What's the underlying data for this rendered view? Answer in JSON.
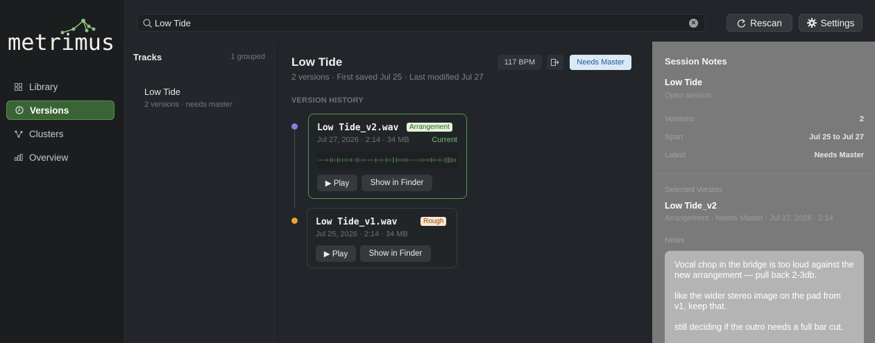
{
  "app": {
    "logo_text": "metrimus"
  },
  "sidebar": {
    "items": [
      {
        "label": "Library",
        "icon": "grid-icon"
      },
      {
        "label": "Versions",
        "icon": "clock-icon",
        "active": true
      },
      {
        "label": "Clusters",
        "icon": "cluster-icon"
      },
      {
        "label": "Overview",
        "icon": "bar-chart-icon"
      }
    ]
  },
  "topbar": {
    "search_value": "Low Tide",
    "rescan_label": "Rescan",
    "settings_label": "Settings"
  },
  "tracks": {
    "title": "Tracks",
    "count": "1 grouped",
    "items": [
      {
        "name": "Low Tide",
        "sub": "2 versions · needs master"
      }
    ]
  },
  "main": {
    "title": "Low Tide",
    "subtitle": "2 versions · First saved Jul 25 · Last modified Jul 27",
    "bpm": "117 BPM",
    "status": "Needs Master",
    "history_label": "VERSION HISTORY",
    "versions": [
      {
        "file": "Low Tide_v2.wav",
        "tag": "Arrangement",
        "meta": "Jul 27, 2026 · 2:14 · 34 MB",
        "current": "Current",
        "play": "▶ Play",
        "finder": "Show in Finder",
        "dot_color": "#8680e0"
      },
      {
        "file": "Low Tide_v1.wav",
        "tag": "Rough",
        "meta": "Jul 25, 2026 · 2:14 · 34 MB",
        "play": "▶ Play",
        "finder": "Show in Finder",
        "dot_color": "#f0a030"
      }
    ]
  },
  "notes": {
    "title": "Session Notes",
    "session_name": "Low Tide",
    "open_label": "Open session",
    "rows": [
      {
        "label": "Versions",
        "value": "2"
      },
      {
        "label": "Span",
        "value": "Jul 25 to Jul 27"
      },
      {
        "label": "Latest",
        "value": "Needs Master"
      }
    ],
    "selected_label": "Selected Version",
    "selected_name": "Low Tide_v2",
    "selected_sub": "Arrangement · Needs Master · Jul 27, 2026 · 2:14",
    "notes_label": "Notes",
    "note_paragraphs": [
      "Vocal chop in the bridge is too loud against the new arrangement — pull back 2-3db.",
      "like the wider stereo image on the pad from v1, keep that.",
      "still deciding if the outro needs a full bar cut."
    ]
  }
}
